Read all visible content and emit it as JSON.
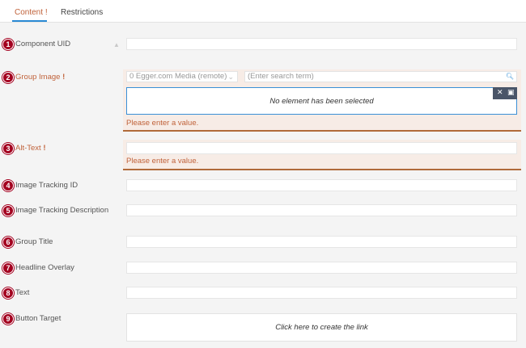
{
  "tabs": [
    {
      "label": "Content",
      "marker": "!"
    },
    {
      "label": "Restrictions"
    }
  ],
  "fields": {
    "component_uid": {
      "number": "1",
      "label": "Component UID"
    },
    "group_image": {
      "number": "2",
      "label": "Group Image",
      "required": "!",
      "media_source": "0 Egger.com Media (remote)",
      "search_placeholder": "(Enter search term)",
      "empty_text": "No element has been selected",
      "error": "Please enter a value."
    },
    "alt_text": {
      "number": "3",
      "label": "Alt-Text",
      "required": "!",
      "error": "Please enter a value."
    },
    "image_tracking_id": {
      "number": "4",
      "label": "Image Tracking ID"
    },
    "image_tracking_description": {
      "number": "5",
      "label": "Image Tracking Description"
    },
    "group_title": {
      "number": "6",
      "label": "Group Title"
    },
    "headline_overlay": {
      "number": "7",
      "label": "Headline Overlay"
    },
    "text": {
      "number": "8",
      "label": "Text"
    },
    "button_target": {
      "number": "9",
      "label": "Button Target",
      "link_text": "Click here to create the link"
    }
  },
  "icons": [
    "lock-icon",
    "chevron-down-icon",
    "search-icon",
    "close-icon",
    "folder-open-icon"
  ],
  "colors": {
    "badge": "#a3001f",
    "error": "#c0623a",
    "accent": "#2a8ad4",
    "error_bg": "#f7ece6"
  }
}
